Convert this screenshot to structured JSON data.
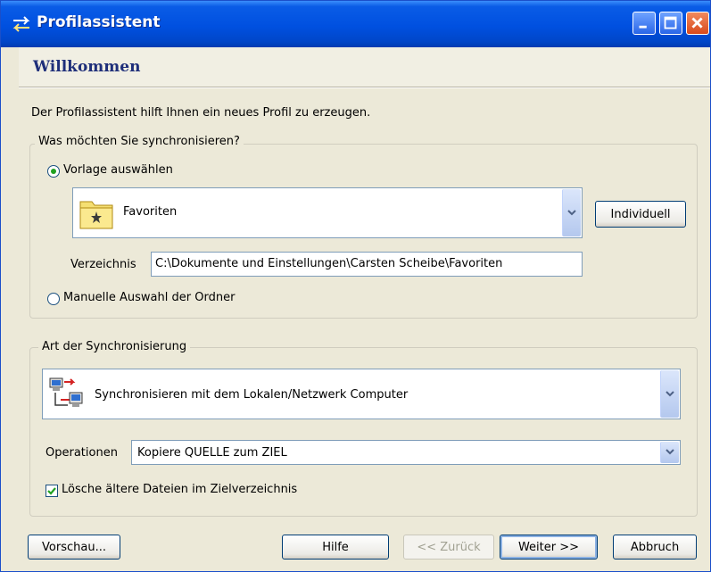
{
  "window": {
    "title": "Profilassistent",
    "heading": "Willkommen",
    "intro": "Der Profilassistent hilft Ihnen ein neues Profil zu erzeugen."
  },
  "sync_what": {
    "legend": "Was möchten Sie synchronisieren?",
    "option_template": {
      "label": "Vorlage auswählen",
      "selected": true
    },
    "template_combo": {
      "value": "Favoriten",
      "icon": "folder-star-icon"
    },
    "individual_button": "Individuell",
    "directory_label": "Verzeichnis",
    "directory_value": "C:\\Dokumente und Einstellungen\\Carsten Scheibe\\Favoriten",
    "option_manual": {
      "label": "Manuelle Auswahl der Ordner",
      "selected": false
    }
  },
  "sync_type": {
    "legend": "Art der Synchronisierung",
    "type_combo": {
      "value": "Synchronisieren mit dem Lokalen/Netzwerk Computer",
      "icon": "network-computer-icon"
    },
    "operations_label": "Operationen",
    "operations_value": "Kopiere QUELLE zum ZIEL",
    "delete_older": {
      "label": "Lösche ältere Dateien im Zielverzeichnis",
      "checked": true
    }
  },
  "footer": {
    "preview": "Vorschau...",
    "help": "Hilfe",
    "back": "<< Zurück",
    "next": "Weiter >>",
    "cancel": "Abbruch"
  },
  "colors": {
    "titlebar": "#0050e0",
    "dialog": "#ece9d8",
    "heading": "#1f2f7a",
    "accent_green": "#21a121"
  }
}
